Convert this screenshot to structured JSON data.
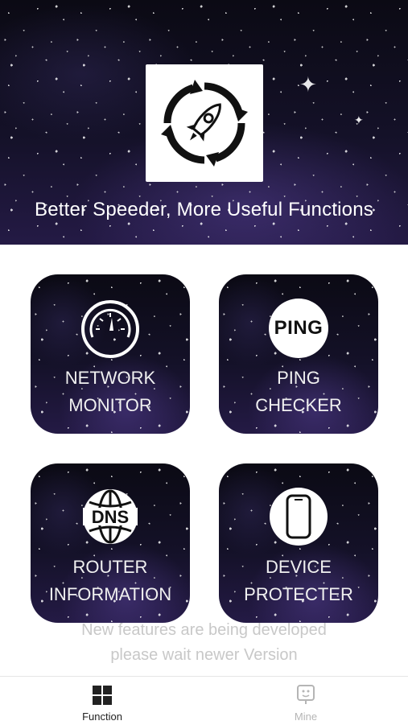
{
  "header": {
    "tagline": "Better Speeder, More Useful Functions",
    "logo_icon": "rocket-refresh-icon"
  },
  "cards": [
    {
      "line1": "NETWORK",
      "line2": "MONITOR",
      "icon": "speedometer-icon"
    },
    {
      "line1": "PING",
      "line2": "CHECKER",
      "icon": "ping-icon",
      "badge_text": "PING"
    },
    {
      "line1": "ROUTER",
      "line2": "INFORMATION",
      "icon": "dns-globe-icon",
      "badge_text": "DNS"
    },
    {
      "line1": "DEVICE",
      "line2": "PROTECTER",
      "icon": "phone-icon"
    }
  ],
  "notice": {
    "line1": "New features are being developed",
    "line2": "please wait newer Version"
  },
  "tabbar": {
    "function_label": "Function",
    "mine_label": "Mine",
    "active_color": "#222222",
    "inactive_color": "#b5b5b5"
  }
}
